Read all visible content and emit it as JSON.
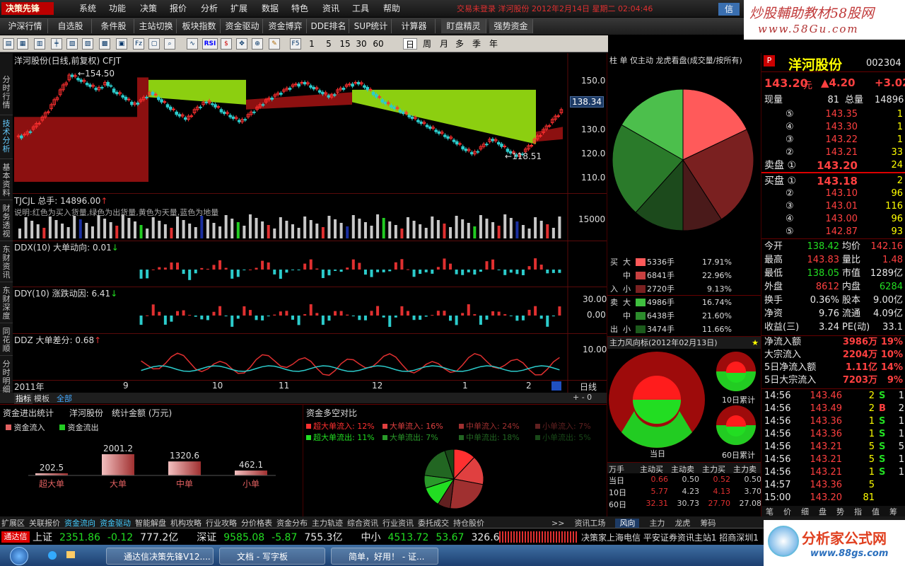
{
  "app": {
    "logo": "决策先锋",
    "menu": [
      "系统",
      "功能",
      "决策",
      "报价",
      "分析",
      "扩展",
      "数据",
      "特色",
      "资讯",
      "工具",
      "帮助"
    ],
    "status": "交易未登录  洋河股份  2012年2月14日 星期二 02:04:46",
    "btn_xin": "信"
  },
  "watermark": {
    "line1": "炒股輔助教材58股网",
    "line2": "www.58Gu.com"
  },
  "funcbar": [
    "沪深行情",
    "自选股",
    "条件股",
    "主站切换",
    "板块指数",
    "资金驱动",
    "资金博弈",
    "DDE排名",
    "SUP统计",
    "计算器",
    "盯盘精灵",
    "强势资金"
  ],
  "toolbar": {
    "icons": [
      "icon-a",
      "icon-b",
      "icon-c",
      "icon-d",
      "icon-e",
      "icon-f",
      "icon-g",
      "icon-h",
      "icon-i",
      "icon-j",
      "icon-k",
      "icon-l",
      "icon-m",
      "icon-n",
      "icon-o",
      "icon-p"
    ],
    "periods": [
      "1",
      "5",
      "15",
      "30",
      "60",
      "日",
      "周",
      "月",
      "多",
      "季",
      "年"
    ]
  },
  "lefttabs": [
    "分时行情",
    "技术分析",
    "基本资料",
    "财务透视",
    "东财资讯",
    "东财深度",
    "同花顺",
    "分时明细"
  ],
  "chart": {
    "title": "洋河股份(日线,前复权) CFJT",
    "ylabels": [
      "150.0",
      "140.0",
      "130.0",
      "120.0",
      "110.0"
    ],
    "cur_price": "138.34",
    "hi_label": "154.50",
    "lo_label": "118.51",
    "vol_title": "TJCJL 总手: 14896.00",
    "vol_note": "说明:红色为买入货量,绿色为出货量,黄色为天量,蓝色为地量",
    "vol_axis": "15000",
    "ddx_title": "DDX(10) 大单动向: 0.01",
    "ddy_title": "DDY(10) 涨跌动因: 6.41",
    "ddy_axis": [
      "30.00",
      "0.00"
    ],
    "ddz_title": "DDZ 大单差分: 0.68",
    "ddz_axis": "10.00",
    "xaxis": [
      "2011年",
      "9",
      "10",
      "11",
      "12",
      "1",
      "2"
    ],
    "xaxis_right": "日线",
    "tabs": [
      "指标",
      "模板",
      "全部"
    ],
    "tab_right": "+  -  0"
  },
  "chart_data": {
    "type": "candlestick",
    "title": "洋河股份(日线,前复权) CFJT",
    "ylim": [
      105,
      158
    ],
    "series": [
      {
        "name": "价格",
        "values": [
          128,
          131,
          135,
          140,
          146,
          152,
          150,
          148,
          146,
          149,
          145,
          143,
          140,
          142,
          145,
          142,
          139,
          136,
          134,
          138,
          141,
          140,
          137,
          135,
          133,
          136,
          139,
          142,
          144,
          146,
          148,
          149,
          147,
          145,
          143,
          146,
          148,
          149,
          147,
          144,
          141,
          139,
          137,
          135,
          133,
          131,
          129,
          127,
          125,
          122,
          120,
          123,
          126,
          124,
          121,
          119,
          122,
          126,
          130,
          134,
          138
        ]
      }
    ]
  },
  "rpanel": {
    "tabs": [
      "柱",
      "单",
      "仅主动",
      "龙虎看盘(成交量/按所有)"
    ],
    "flow": [
      {
        "side": "买",
        "size": "大",
        "hands": "5336手",
        "pct": "17.91%",
        "color": "#ff5a5a"
      },
      {
        "side": "",
        "size": "中",
        "hands": "6841手",
        "pct": "22.96%",
        "color": "#c84040"
      },
      {
        "side": "入",
        "size": "小",
        "hands": "2720手",
        "pct": "9.13%",
        "color": "#7a2020"
      },
      {
        "side": "卖",
        "size": "大",
        "hands": "4986手",
        "pct": "16.74%",
        "color": "#3fbf3f"
      },
      {
        "side": "",
        "size": "中",
        "hands": "6438手",
        "pct": "21.60%",
        "color": "#2c8c2c"
      },
      {
        "side": "出",
        "size": "小",
        "hands": "3474手",
        "pct": "11.66%",
        "color": "#1c5a1c"
      }
    ],
    "wind_title": "主力风向标(2012年02月13日)",
    "lbl_today": "当日",
    "lbl_10": "10日累计",
    "lbl_60": "60日累计",
    "table_head": [
      "万手",
      "主动买",
      "主动卖",
      "主力买",
      "主力卖"
    ],
    "table_rows": [
      [
        "当日",
        "0.66",
        "0.50",
        "0.52",
        "0.50"
      ],
      [
        "10日",
        "5.77",
        "4.23",
        "4.13",
        "3.70"
      ],
      [
        "60日",
        "32.31",
        "30.73",
        "27.70",
        "27.08"
      ]
    ]
  },
  "quote": {
    "code_mark": "P",
    "name": "洋河股份",
    "code": "002304",
    "price": "143.20",
    "price_unit": "元",
    "change": "▲4.20",
    "change2": "+3.02",
    "now_vol_label": "现量",
    "now_vol": "81",
    "tot_vol_label": "总量",
    "tot_vol": "14896",
    "sell": [
      [
        "⑤",
        "143.35",
        "1"
      ],
      [
        "④",
        "143.30",
        "1"
      ],
      [
        "③",
        "143.22",
        "1"
      ],
      [
        "②",
        "143.21",
        "33"
      ],
      [
        "卖盘 ①",
        "143.20",
        "24"
      ]
    ],
    "buy": [
      [
        "买盘 ①",
        "143.18",
        "2"
      ],
      [
        "②",
        "143.10",
        "96"
      ],
      [
        "③",
        "143.01",
        "116"
      ],
      [
        "④",
        "143.00",
        "96"
      ],
      [
        "⑤",
        "142.87",
        "93"
      ]
    ],
    "stats": [
      [
        "今开",
        "138.42",
        "均价",
        "142.16"
      ],
      [
        "最高",
        "143.83",
        "量比",
        "1.48"
      ],
      [
        "最低",
        "138.05",
        "市值",
        "1289亿"
      ],
      [
        "外盘",
        "8612",
        "内盘",
        "6284"
      ],
      [
        "换手",
        "0.36%",
        "股本",
        "9.00亿"
      ],
      [
        "净资",
        "9.76",
        "流通",
        "4.09亿"
      ],
      [
        "收益(三)",
        "3.24",
        "PE(动)",
        "33.1"
      ]
    ],
    "flows": [
      [
        "净流入额",
        "3986万",
        "19%"
      ],
      [
        "大宗流入",
        "2204万",
        "10%"
      ],
      [
        "5日净流入额",
        "1.11亿",
        "14%"
      ],
      [
        "5日大宗流入",
        "7203万",
        "9%"
      ]
    ],
    "ticks": [
      [
        "14:56",
        "143.46",
        "2",
        "S",
        "1"
      ],
      [
        "14:56",
        "143.49",
        "2",
        "B",
        "2"
      ],
      [
        "14:56",
        "143.36",
        "1",
        "S",
        "1"
      ],
      [
        "14:56",
        "143.36",
        "1",
        "S",
        "1"
      ],
      [
        "14:56",
        "143.21",
        "5",
        "S",
        "5"
      ],
      [
        "14:56",
        "143.21",
        "5",
        "S",
        "1"
      ],
      [
        "14:56",
        "143.21",
        "1",
        "S",
        "1"
      ],
      [
        "14:57",
        "143.36",
        "5",
        "",
        ""
      ],
      [
        "15:00",
        "143.20",
        "81",
        "",
        ""
      ]
    ],
    "tabs": [
      "笔",
      "价",
      "细",
      "盘",
      "势",
      "指",
      "值",
      "筹"
    ]
  },
  "bpanel1": {
    "tabs": [
      "资金进出统计",
      "洋河股份",
      "统计金额 (万元)"
    ],
    "legend_in": "资金流入",
    "legend_out": "资金流出",
    "bars": [
      {
        "label": "超大单",
        "value": "202.5"
      },
      {
        "label": "大单",
        "value": "2001.2"
      },
      {
        "label": "中单",
        "value": "1320.6"
      },
      {
        "label": "小单",
        "value": "462.1"
      }
    ]
  },
  "bpanel2": {
    "title": "资金多空对比",
    "legend": [
      [
        "超大单流入:",
        "12%",
        "#ff3030"
      ],
      [
        "大单流入:",
        "16%",
        "#e04040"
      ],
      [
        "中单流入:",
        "24%",
        "#a03030"
      ],
      [
        "小单流入:",
        "7%",
        "#602020"
      ],
      [
        "超大单流出:",
        "11%",
        "#22dd22"
      ],
      [
        "大单流出:",
        "7%",
        "#2a9a2a"
      ],
      [
        "中单流出:",
        "18%",
        "#226622"
      ],
      [
        "小单流出:",
        "5%",
        "#184818"
      ]
    ]
  },
  "btabs_bottom": [
    "扩展区",
    "关联报价",
    "资金流向",
    "资金驱动",
    "智能解盘",
    "机构攻略",
    "行业攻略",
    "分价格表",
    "资金分布",
    "主力轨迹",
    "综合资讯",
    "行业资讯",
    "委托成交",
    "持仓股价"
  ],
  "bnav_right": [
    ">>",
    "资讯工场",
    "风向",
    "主力",
    "龙虎",
    "筹码"
  ],
  "ticker": {
    "label": "通达信",
    "items": [
      [
        "上证",
        "2351.86",
        "-0.12",
        "777.2亿"
      ],
      [
        "深证",
        "9585.08",
        "-5.87",
        "755.3亿"
      ],
      [
        "中小",
        "4513.72",
        "53.67",
        "326.6亿"
      ]
    ],
    "news": "决策家上海电信  平安证券资讯主站1  招商深圳1"
  },
  "taskbar": [
    "通达信决策先锋V12....",
    "文档 - 写字板",
    "简单，好用！ - 证..."
  ],
  "brand": {
    "name": "分析家公式网",
    "url": "www.88gs.com"
  }
}
